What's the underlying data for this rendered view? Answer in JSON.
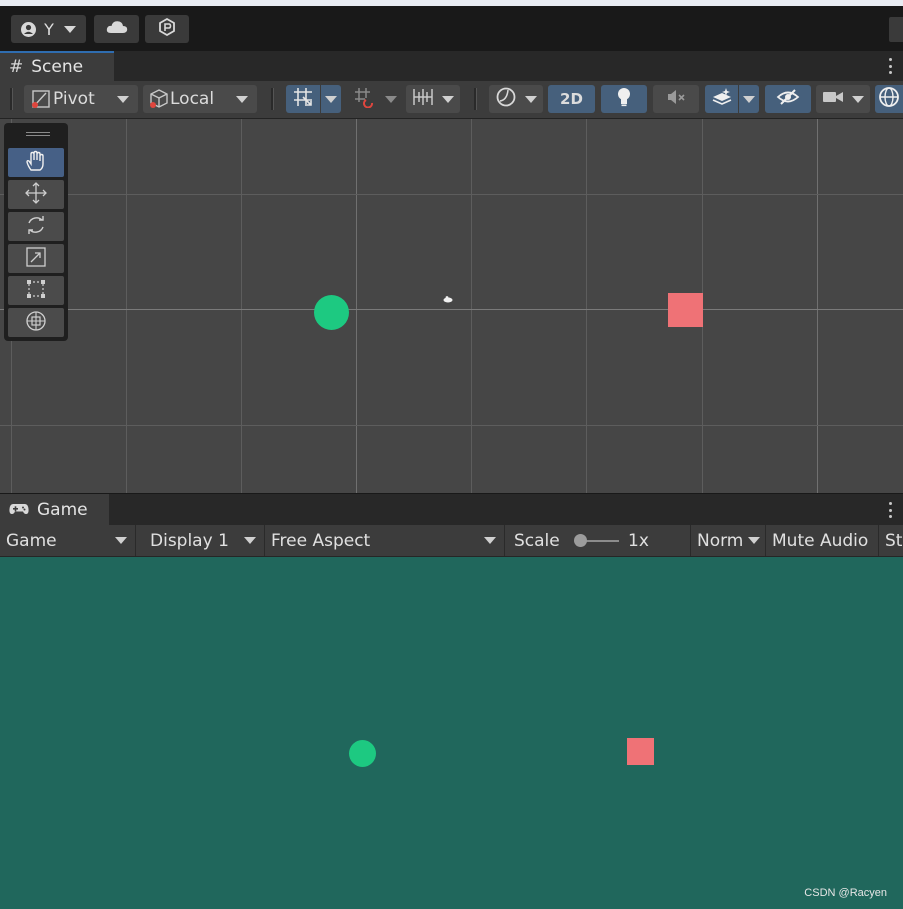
{
  "toolbar": {
    "account_label": "Y",
    "icons": [
      "account-icon",
      "cloud-icon",
      "collab-icon"
    ]
  },
  "scene_panel": {
    "tab_label": "Scene",
    "pivot_label": "Pivot",
    "local_label": "Local",
    "mode_2d_label": "2D"
  },
  "game_panel": {
    "tab_label": "Game",
    "view_select": "Game",
    "display_select": "Display 1",
    "aspect_select": "Free Aspect",
    "scale_label": "Scale",
    "scale_value": "1x",
    "norm_select": "Norm",
    "mute_audio_label": "Mute Audio",
    "stats_label_partial": "St"
  },
  "colors": {
    "circle": "#1dc981",
    "square": "#ef7276",
    "game_background": "#20675c",
    "scene_background": "#464646",
    "active_tool": "#466086"
  },
  "watermark": "CSDN @Racyen"
}
